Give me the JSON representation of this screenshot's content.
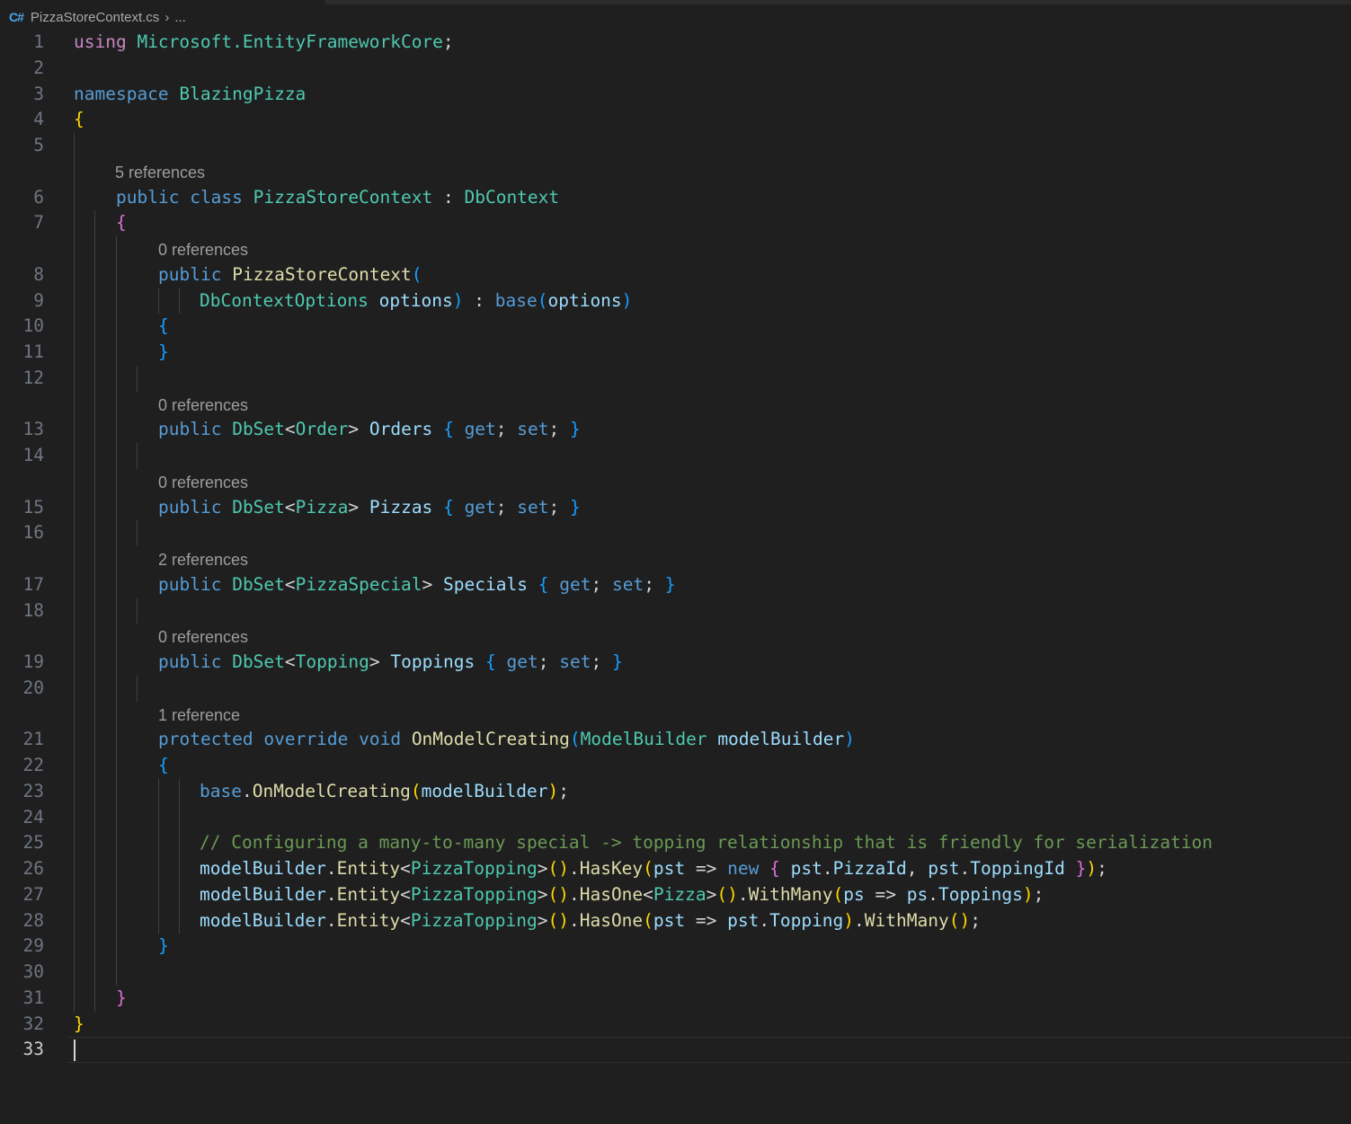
{
  "window": {
    "tab_filename": "PizzaStoreContext.cs",
    "breadcrumb_more": "...",
    "file_icon": "csharp-file-icon"
  },
  "editor": {
    "active_line": "33",
    "line_numbers": [
      "1",
      "2",
      "3",
      "4",
      "5",
      "6",
      "7",
      "8",
      "9",
      "10",
      "11",
      "12",
      "13",
      "14",
      "15",
      "16",
      "17",
      "18",
      "19",
      "20",
      "21",
      "22",
      "23",
      "24",
      "25",
      "26",
      "27",
      "28",
      "29",
      "30",
      "31",
      "32",
      "33"
    ],
    "codelens": {
      "class": "5 references",
      "ctor": "0 references",
      "orders": "0 references",
      "pizzas": "0 references",
      "specials": "2 references",
      "toppings": "0 references",
      "onmodel": "1 reference"
    },
    "code": {
      "l1": [
        "using",
        "Microsoft.EntityFrameworkCore",
        ";"
      ],
      "l3": [
        "namespace",
        "BlazingPizza"
      ],
      "l4": [
        "{"
      ],
      "l6": [
        "public",
        "class",
        "PizzaStoreContext",
        " : ",
        "DbContext"
      ],
      "l7": [
        "{"
      ],
      "l8": [
        "public",
        "PizzaStoreContext",
        "("
      ],
      "l9": [
        "DbContextOptions",
        "options",
        ")",
        " : ",
        "base",
        "(",
        "options",
        ")"
      ],
      "l10": [
        "{"
      ],
      "l11": [
        "}"
      ],
      "l13": [
        "public",
        "DbSet",
        "<",
        "Order",
        ">",
        "Orders",
        "{",
        "get",
        ";",
        "set",
        ";",
        "}"
      ],
      "l15": [
        "public",
        "DbSet",
        "<",
        "Pizza",
        ">",
        "Pizzas",
        "{",
        "get",
        ";",
        "set",
        ";",
        "}"
      ],
      "l17": [
        "public",
        "DbSet",
        "<",
        "PizzaSpecial",
        ">",
        "Specials",
        "{",
        "get",
        ";",
        "set",
        ";",
        "}"
      ],
      "l19": [
        "public",
        "DbSet",
        "<",
        "Topping",
        ">",
        "Toppings",
        "{",
        "get",
        ";",
        "set",
        ";",
        "}"
      ],
      "l21": [
        "protected",
        "override",
        "void",
        "OnModelCreating",
        "(",
        "ModelBuilder",
        "modelBuilder",
        ")"
      ],
      "l22": [
        "{"
      ],
      "l23": [
        "base",
        ".",
        "OnModelCreating",
        "(",
        "modelBuilder",
        ")",
        ";"
      ],
      "l25": [
        "// Configuring a many-to-many special -> topping relationship that is friendly for serialization"
      ],
      "l26": [
        "modelBuilder",
        ".",
        "Entity",
        "<",
        "PizzaTopping",
        ">",
        "()",
        ".",
        "HasKey",
        "(",
        "pst",
        " => ",
        "new",
        "{",
        "pst",
        ".",
        "PizzaId",
        ", ",
        "pst",
        ".",
        "ToppingId",
        "}",
        ")",
        ";"
      ],
      "l27": [
        "modelBuilder",
        ".",
        "Entity",
        "<",
        "PizzaTopping",
        ">",
        "()",
        ".",
        "HasOne",
        "<",
        "Pizza",
        ">",
        "()",
        ".",
        "WithMany",
        "(",
        "ps",
        " => ",
        "ps",
        ".",
        "Toppings",
        ")",
        ";"
      ],
      "l28": [
        "modelBuilder",
        ".",
        "Entity",
        "<",
        "PizzaTopping",
        ">",
        "()",
        ".",
        "HasOne",
        "(",
        "pst",
        " => ",
        "pst",
        ".",
        "Topping",
        ")",
        ".",
        "WithMany",
        "()",
        ";"
      ],
      "l29": [
        "}"
      ],
      "l31": [
        "}"
      ],
      "l32": [
        "}"
      ]
    }
  }
}
